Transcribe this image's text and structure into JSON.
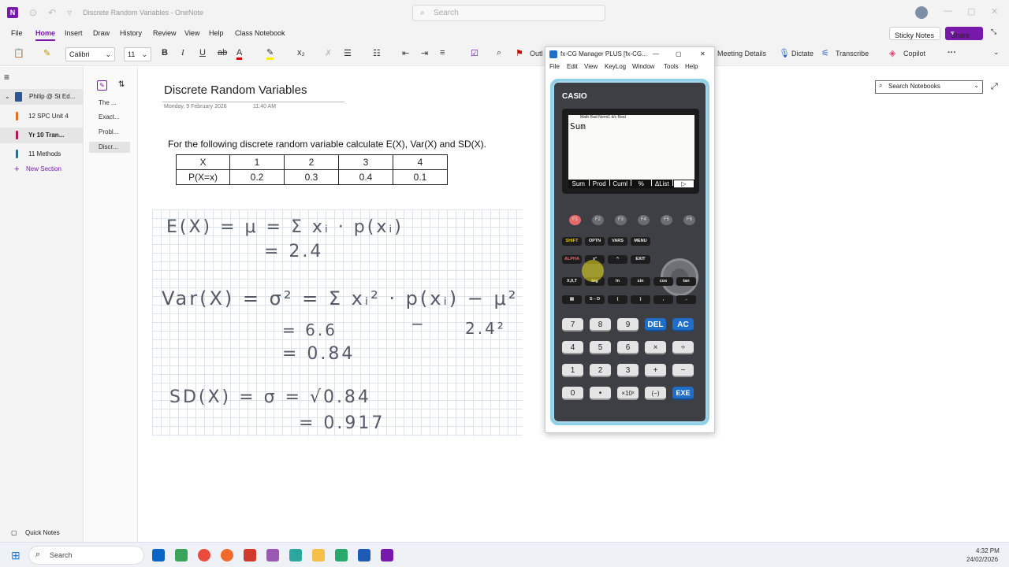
{
  "window": {
    "title": "Discrete Random Variables - OneNote",
    "search_placeholder": "Search"
  },
  "menu": {
    "items": [
      "File",
      "Home",
      "Insert",
      "Draw",
      "History",
      "Review",
      "View",
      "Help",
      "Class Notebook"
    ],
    "sticky_notes": "Sticky Notes",
    "share": "Share"
  },
  "ribbon": {
    "font": "Calibri",
    "font_size": "11",
    "bold": "B",
    "italic": "I",
    "underline": "U",
    "outlook_partial": "Outl",
    "meeting_details": "Meeting Details",
    "dictate": "Dictate",
    "transcribe": "Transcribe",
    "copilot": "Copilot",
    "more": "···",
    "search_notebooks": "Search Notebooks"
  },
  "notebooks": [
    {
      "label": "Philip @ St Ed...",
      "color": "#2b5797"
    },
    {
      "label": "12 SPC Unit 4",
      "color": "#e07020"
    },
    {
      "label": "Yr 10 Tran...",
      "color": "#b0155a"
    },
    {
      "label": "11 Methods",
      "color": "#2b6e8a"
    }
  ],
  "new_section": "New Section",
  "quick_notes": "Quick Notes",
  "pages": [
    "The ...",
    "Exact...",
    "Probl...",
    "Discr..."
  ],
  "page": {
    "title": "Discrete Random Variables",
    "date": "Monday, 9 February 2026",
    "time": "11:40 AM",
    "question": "For the following discrete random variable calculate E(X), Var(X) and SD(X).",
    "table": {
      "row1": [
        "X",
        "1",
        "2",
        "3",
        "4"
      ],
      "row2": [
        "P(X=x)",
        "0.2",
        "0.3",
        "0.4",
        "0.1"
      ]
    },
    "handwriting": {
      "l1": "E(X) = μ = Σ xᵢ · p(xᵢ)",
      "l2": "= 2.4",
      "l3": "Var(X) = σ² = Σ xᵢ² · p(xᵢ) − μ²",
      "l4a": "= 6.6",
      "l4b": "−",
      "l4c": "2.4²",
      "l5": "= 0.84",
      "l6": "SD(X) = σ = √0.84",
      "l7": "= 0.917"
    }
  },
  "calc": {
    "title": "fx-CG Manager PLUS [fx-CG...",
    "menu": [
      "File",
      "Edit",
      "View",
      "KeyLog",
      "Window",
      "Tools",
      "Help"
    ],
    "brand": "CASIO",
    "status": "Math Rad Norm1 d/c Real",
    "screen_text": "Sum",
    "softkeys": [
      "Sum",
      "Prod",
      "Cuml",
      "%",
      "ΔList",
      "▷"
    ],
    "fkeys": [
      "F1",
      "F2",
      "F3",
      "F4",
      "F5",
      "F6"
    ],
    "row_a": [
      "SHIFT",
      "OPTN",
      "VARS",
      "MENU"
    ],
    "row_b": [
      "ALPHA",
      "x²",
      "^",
      "EXIT"
    ],
    "row_c": [
      "X,θ,T",
      "log",
      "ln",
      "sin",
      "cos",
      "tan"
    ],
    "row_d": [
      "▤",
      "S⇔D",
      "(",
      ")",
      ",",
      "→"
    ],
    "row_e": [
      "7",
      "8",
      "9",
      "DEL",
      "AC"
    ],
    "row_f": [
      "4",
      "5",
      "6",
      "×",
      "÷"
    ],
    "row_g": [
      "1",
      "2",
      "3",
      "+",
      "−"
    ],
    "row_h": [
      "0",
      "•",
      "×10ˣ",
      "(−)",
      "EXE"
    ]
  },
  "taskbar": {
    "search": "Search",
    "time": "4:32 PM",
    "date": "24/02/2026"
  }
}
